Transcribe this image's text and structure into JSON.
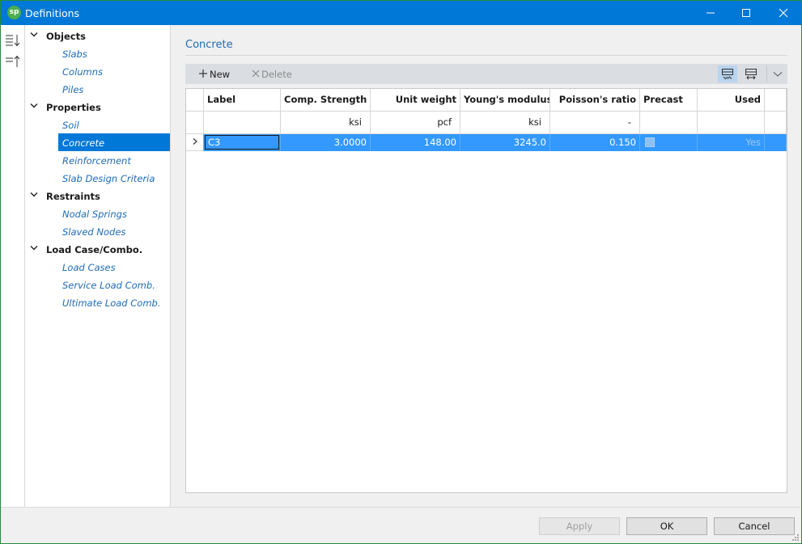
{
  "window": {
    "app_icon_text": "sp",
    "title": "Definitions"
  },
  "tree": {
    "groups": [
      {
        "label": "Objects",
        "items": [
          "Slabs",
          "Columns",
          "Piles"
        ]
      },
      {
        "label": "Properties",
        "items": [
          "Soil",
          "Concrete",
          "Reinforcement",
          "Slab Design Criteria"
        ]
      },
      {
        "label": "Restraints",
        "items": [
          "Nodal Springs",
          "Slaved Nodes"
        ]
      },
      {
        "label": "Load Case/Combo.",
        "items": [
          "Load Cases",
          "Service Load Comb.",
          "Ultimate Load Comb."
        ]
      }
    ],
    "selected_item": "Concrete"
  },
  "main": {
    "section_title": "Concrete",
    "toolbar": {
      "new_label": "New",
      "delete_label": "Delete"
    },
    "grid": {
      "columns": [
        "Label",
        "Comp. Strength",
        "Unit weight",
        "Young's modulus",
        "Poisson's ratio",
        "Precast",
        "Used"
      ],
      "units": [
        "",
        "ksi",
        "pcf",
        "ksi",
        "-",
        "",
        ""
      ],
      "rows": [
        {
          "label": "C3",
          "comp_strength": "3.0000",
          "unit_weight": "148.00",
          "youngs_modulus": "3245.0",
          "poissons_ratio": "0.150",
          "precast": false,
          "used": "Yes"
        }
      ]
    }
  },
  "footer": {
    "apply_label": "Apply",
    "ok_label": "OK",
    "cancel_label": "Cancel"
  }
}
